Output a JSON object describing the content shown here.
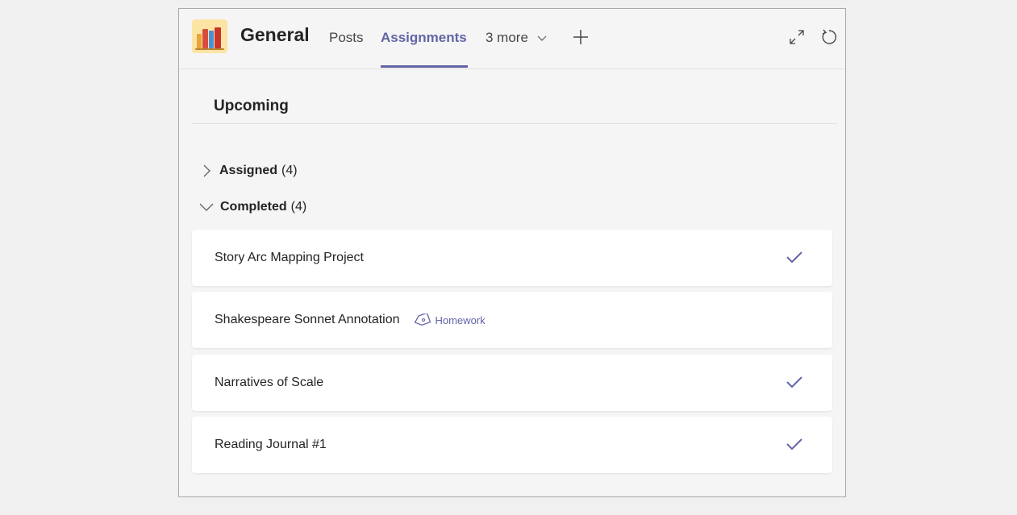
{
  "header": {
    "channel_name": "General",
    "tabs": [
      {
        "label": "Posts",
        "active": false
      },
      {
        "label": "Assignments",
        "active": true
      },
      {
        "label": "3 more",
        "active": false
      }
    ],
    "add_tab_icon": "plus-icon",
    "expand_icon": "expand-icon",
    "refresh_icon": "refresh-icon"
  },
  "section": {
    "title": "Upcoming"
  },
  "groups": [
    {
      "label": "Assigned",
      "count": "(4)",
      "expanded": false
    },
    {
      "label": "Completed",
      "count": "(4)",
      "expanded": true
    }
  ],
  "assignments": [
    {
      "title": "Story Arc Mapping Project",
      "tag": "",
      "completed": true
    },
    {
      "title": "Shakespeare Sonnet Annotation",
      "tag": "Homework",
      "completed": false
    },
    {
      "title": "Narratives of Scale",
      "tag": "",
      "completed": true
    },
    {
      "title": "Reading Journal #1",
      "tag": "",
      "completed": true
    }
  ],
  "colors": {
    "accent": "#6264a7",
    "background": "#f5f5f5",
    "card": "#ffffff"
  }
}
